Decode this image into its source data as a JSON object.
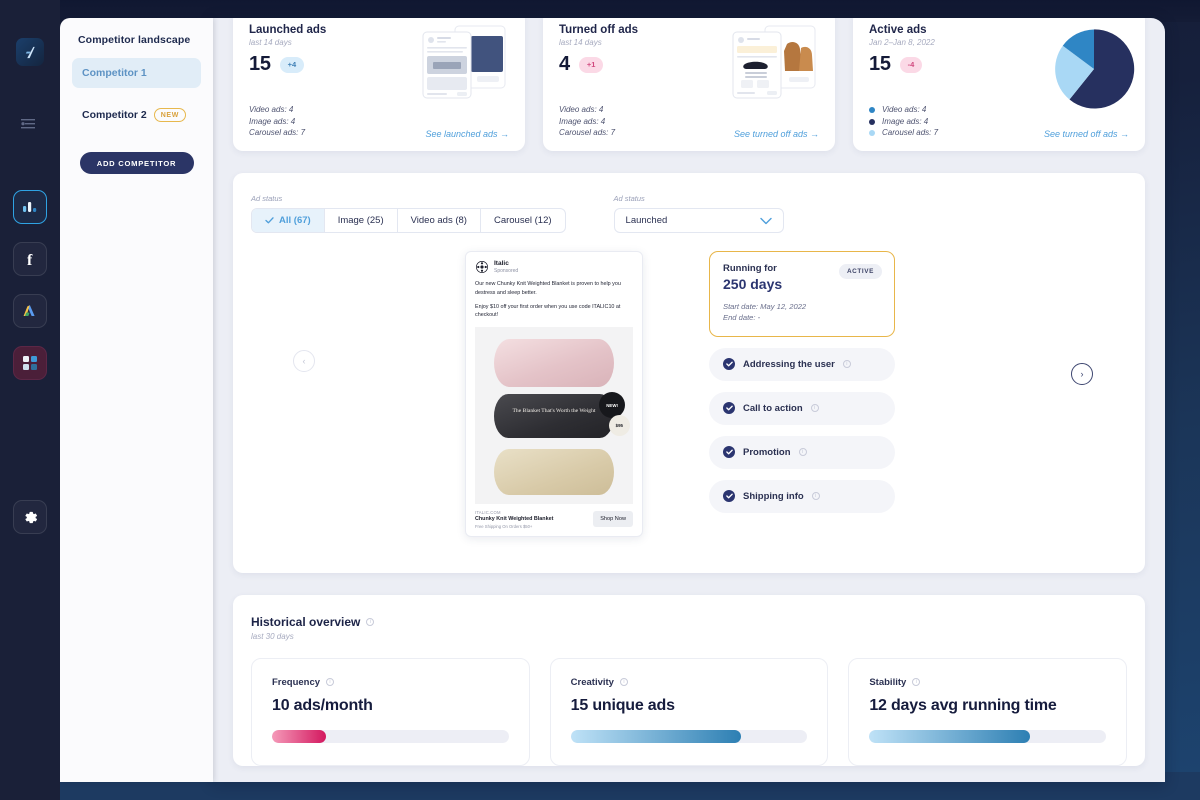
{
  "sidebar": {
    "title": "Competitor landscape",
    "items": [
      {
        "label": "Competitor 1",
        "selected": true,
        "badge": ""
      },
      {
        "label": "Competitor 2",
        "selected": false,
        "badge": "NEW"
      }
    ],
    "add_button": "ADD COMPETITOR"
  },
  "rail": {
    "logo": "app-logo",
    "icons": [
      "collapse-icon",
      "analytics-icon",
      "facebook-icon",
      "google-ads-icon",
      "apps-icon",
      "gear-icon"
    ]
  },
  "stat_cards": [
    {
      "title": "Launched ads",
      "subtitle": "last 14 days",
      "value": "15",
      "delta": "+4",
      "delta_tone": "blue",
      "breakdown": [
        {
          "label": "Video ads: 4",
          "color": "#2f86c5"
        },
        {
          "label": "Image ads: 4",
          "color": "#26305f"
        },
        {
          "label": "Carousel ads: 7",
          "color": "#a9d8f5"
        }
      ],
      "link": "See launched ads →",
      "thumb": "launched-ads-thumbnail",
      "show_dots": false,
      "show_pie": false
    },
    {
      "title": "Turned off ads",
      "subtitle": "last 14 days",
      "value": "4",
      "delta": "+1",
      "delta_tone": "pink",
      "breakdown": [
        {
          "label": "Video ads: 4",
          "color": "#2f86c5"
        },
        {
          "label": "Image ads: 4",
          "color": "#26305f"
        },
        {
          "label": "Carousel ads: 7",
          "color": "#a9d8f5"
        }
      ],
      "link": "See turned off ads →",
      "thumb": "turned-off-ads-thumbnail",
      "show_dots": false,
      "show_pie": false
    },
    {
      "title": "Active ads",
      "subtitle": "Jan 2–Jan 8, 2022",
      "value": "15",
      "delta": "-4",
      "delta_tone": "pink",
      "breakdown": [
        {
          "label": "Video ads: 4",
          "color": "#2f86c5"
        },
        {
          "label": "Image ads: 4",
          "color": "#26305f"
        },
        {
          "label": "Carousel ads: 7",
          "color": "#a9d8f5"
        }
      ],
      "link": "See turned off ads →",
      "thumb": "active-ads-pie-chart",
      "show_dots": true,
      "show_pie": true
    }
  ],
  "chart_data": {
    "type": "pie",
    "title": "Active ads",
    "subtitle": "Jan 2–Jan 8, 2022",
    "categories": [
      "Image ads",
      "Carousel ads",
      "Video ads"
    ],
    "values": [
      4,
      7,
      4
    ],
    "percent": [
      60,
      27,
      13
    ],
    "colors": [
      "#26305f",
      "#a9d8f5",
      "#2f86c5"
    ],
    "legend": [
      "Video ads: 4",
      "Image ads: 4",
      "Carousel ads: 7"
    ],
    "legend_position": "left",
    "grid": false
  },
  "filters": {
    "left_label": "Ad status",
    "right_label": "Ad status",
    "segments": [
      {
        "label": "All (67)",
        "active": true
      },
      {
        "label": "Image (25)",
        "active": false
      },
      {
        "label": "Video ads (8)",
        "active": false
      },
      {
        "label": "Carousel (12)",
        "active": false
      }
    ],
    "select_value": "Launched"
  },
  "ad_preview": {
    "brand": "Italic",
    "sponsored": "Sponsored",
    "body_1": "Our new Chunky Knit Weighted Blanket is proven to help you destress and sleep better.",
    "body_2": "Enjoy $10 off your first order when you use code ITALIC10 at checkout!",
    "image_overlay_text": "The Blanket That's Worth the Weight",
    "new_badge": "NEW!",
    "price_badge": "$95",
    "footer_domain": "ITALIC.COM",
    "footer_title": "Chunky Knit Weighted Blanket",
    "footer_shipping": "Free Shipping On Orders $50+",
    "cta": "Shop Now",
    "prev_arrow": "‹",
    "next_arrow": "›"
  },
  "ad_detail": {
    "running_label": "Running for",
    "running_value": "250 days",
    "status": "ACTIVE",
    "start_date": "Start date: May 12, 2022",
    "end_date": "End date: -",
    "tags": [
      {
        "label": "Addressing the user",
        "checked": true
      },
      {
        "label": "Call to action",
        "checked": true
      },
      {
        "label": "Promotion",
        "checked": true
      },
      {
        "label": "Shipping info",
        "checked": true
      }
    ]
  },
  "historical": {
    "title": "Historical overview",
    "subtitle": "last 30 days",
    "cards": [
      {
        "label": "Frequency",
        "value": "10 ads/month",
        "progress": 23,
        "tone": "pink"
      },
      {
        "label": "Creativity",
        "value": "15 unique ads",
        "progress": 72,
        "tone": "blue"
      },
      {
        "label": "Stability",
        "value": "12 days avg running time",
        "progress": 68,
        "tone": "blue"
      }
    ]
  }
}
